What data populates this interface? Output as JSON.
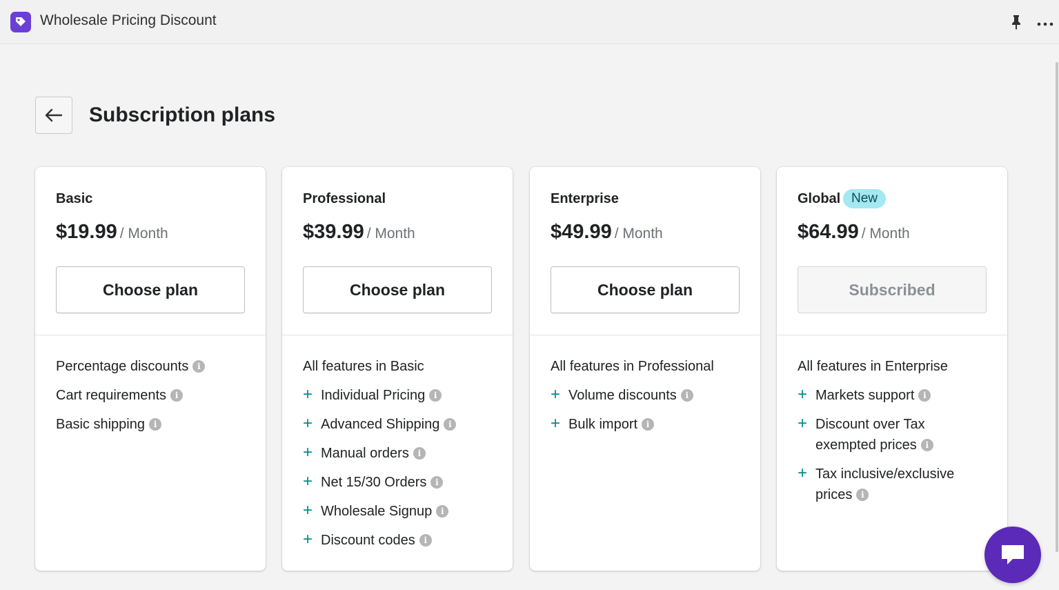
{
  "app": {
    "title": "Wholesale Pricing Discount",
    "brand_color": "#6b3fd6",
    "icons": [
      "tag-icon",
      "pin-icon",
      "more-icon"
    ]
  },
  "page": {
    "title": "Subscription plans",
    "back_icon": "arrow-left-icon"
  },
  "plans": [
    {
      "name": "Basic",
      "badge": "",
      "price": "$19.99",
      "period": "/ Month",
      "button": "Choose plan",
      "features": [
        {
          "text": "Percentage discounts",
          "plus": false
        },
        {
          "text": "Cart requirements",
          "plus": false
        },
        {
          "text": "Basic shipping",
          "plus": false
        }
      ]
    },
    {
      "name": "Professional",
      "badge": "",
      "price": "$39.99",
      "period": "/ Month",
      "button": "Choose plan",
      "features": [
        {
          "text": "All features in Basic",
          "plus": false,
          "info": false
        },
        {
          "text": "Individual Pricing",
          "plus": true
        },
        {
          "text": "Advanced Shipping",
          "plus": true
        },
        {
          "text": "Manual orders",
          "plus": true
        },
        {
          "text": "Net 15/30 Orders",
          "plus": true
        },
        {
          "text": "Wholesale Signup",
          "plus": true
        },
        {
          "text": "Discount codes",
          "plus": true
        }
      ]
    },
    {
      "name": "Enterprise",
      "badge": "",
      "price": "$49.99",
      "period": "/ Month",
      "button": "Choose plan",
      "features": [
        {
          "text": "All features in Professional",
          "plus": false,
          "info": false
        },
        {
          "text": "Volume discounts",
          "plus": true
        },
        {
          "text": "Bulk import",
          "plus": true
        }
      ]
    },
    {
      "name": "Global",
      "badge": "New",
      "price": "$64.99",
      "period": "/ Month",
      "button": "Subscribed",
      "button_disabled": true,
      "features": [
        {
          "text": "All features in Enterprise",
          "plus": false,
          "info": false
        },
        {
          "text": "Markets support",
          "plus": true
        },
        {
          "text": "Discount over Tax exempted prices",
          "plus": true
        },
        {
          "text": "Tax inclusive/exclusive prices",
          "plus": true
        }
      ]
    }
  ],
  "chat": {
    "icon": "chat-icon",
    "color": "#5b2ab8"
  }
}
